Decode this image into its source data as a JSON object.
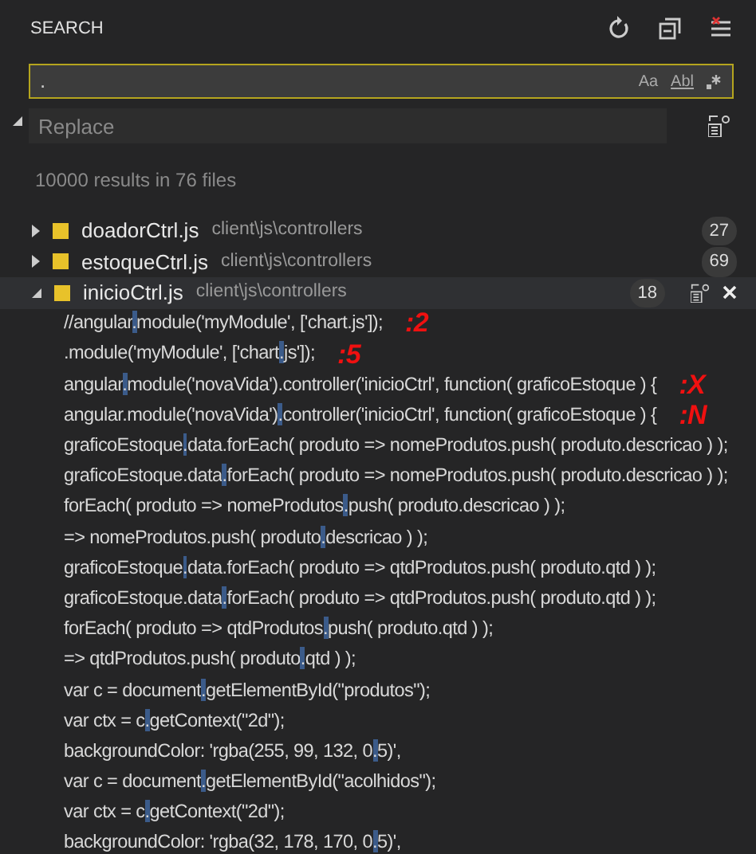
{
  "panel": {
    "title": "SEARCH"
  },
  "search": {
    "value": ".",
    "options": [
      "Aa",
      "Abl"
    ]
  },
  "replace": {
    "placeholder": "Replace",
    "expanded": true
  },
  "summary": "10000 results in 76 files",
  "files": [
    {
      "name": "doadorCtrl.js",
      "path": "client\\js\\controllers",
      "count": "27",
      "expanded": false,
      "selected": false
    },
    {
      "name": "estoqueCtrl.js",
      "path": "client\\js\\controllers",
      "count": "69",
      "expanded": false,
      "selected": false
    },
    {
      "name": "inicioCtrl.js",
      "path": "client\\js\\controllers",
      "count": "18",
      "expanded": true,
      "selected": true,
      "matches": [
        {
          "before": "//angular",
          "match": ".",
          "after": "module('myModule', ['chart.js']);",
          "note": ":2"
        },
        {
          "before": ".module('myModule', ['chart",
          "match": ".",
          "after": "js']);",
          "note": ":5"
        },
        {
          "before": "angular",
          "match": ".",
          "after": "module('novaVida').controller('inicioCtrl', function( graficoEstoque ) {",
          "note": ":X"
        },
        {
          "before": "angular.module('novaVida')",
          "match": ".",
          "after": "controller('inicioCtrl', function( graficoEstoque ) {",
          "note": ":N"
        },
        {
          "before": "graficoEstoque",
          "match": ".",
          "after": "data.forEach( produto => nomeProdutos.push( produto.descricao ) );"
        },
        {
          "before": "graficoEstoque.data",
          "match": ".",
          "after": "forEach( produto => nomeProdutos.push( produto.descricao ) );"
        },
        {
          "before": "forEach( produto => nomeProdutos",
          "match": ".",
          "after": "push( produto.descricao ) );"
        },
        {
          "before": "=> nomeProdutos.push( produto",
          "match": ".",
          "after": "descricao ) );"
        },
        {
          "before": "graficoEstoque",
          "match": ".",
          "after": "data.forEach( produto => qtdProdutos.push( produto.qtd ) );"
        },
        {
          "before": "graficoEstoque.data",
          "match": ".",
          "after": "forEach( produto => qtdProdutos.push( produto.qtd ) );"
        },
        {
          "before": "forEach( produto => qtdProdutos",
          "match": ".",
          "after": "push( produto.qtd ) );"
        },
        {
          "before": "=> qtdProdutos.push( produto",
          "match": ".",
          "after": "qtd ) );"
        },
        {
          "before": "var c = document",
          "match": ".",
          "after": "getElementById(\"produtos\");"
        },
        {
          "before": "var ctx = c",
          "match": ".",
          "after": "getContext(\"2d\");"
        },
        {
          "before": "backgroundColor: 'rgba(255, 99, 132, 0",
          "match": ".",
          "after": "5)',"
        },
        {
          "before": "var c = document",
          "match": ".",
          "after": "getElementById(\"acolhidos\");"
        },
        {
          "before": "var ctx = c",
          "match": ".",
          "after": "getContext(\"2d\");"
        },
        {
          "before": "backgroundColor: 'rgba(32, 178, 170, 0",
          "match": ".",
          "after": "5)',"
        }
      ]
    }
  ]
}
